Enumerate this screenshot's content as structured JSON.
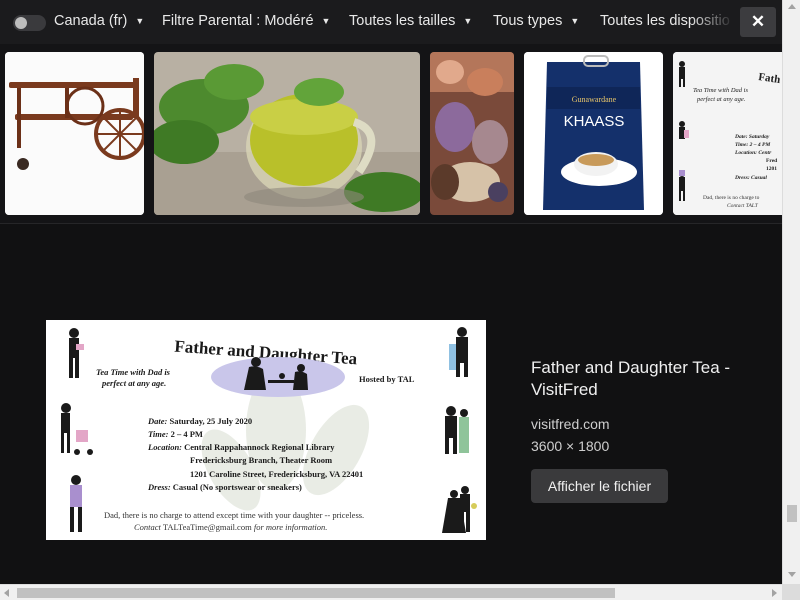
{
  "filters": {
    "safesearch_toggle": "off",
    "region": "Canada (fr)",
    "parental": "Filtre Parental : Modéré",
    "sizes": "Toutes les tailles",
    "types": "Tous types",
    "layouts": "Toutes les dispositions"
  },
  "thumbnails": [
    {
      "label": "wooden tea cart"
    },
    {
      "label": "mint tea in glass cup"
    },
    {
      "label": "tea party with stuffed animals"
    },
    {
      "label": "Khaass tea package",
      "brand": "KHAASS",
      "sub": "Gunawardane"
    },
    {
      "label": "father and daughter tea flyer"
    }
  ],
  "thumb_flyer": {
    "title": "Fath",
    "tagline_1": "Tea Time with Dad is",
    "tagline_2": "perfect at any age.",
    "date": "Date: Saturday",
    "time": "Time: 2 – 4 PM",
    "location": "Location: Centr",
    "l1": "Fred",
    "l2": "1201",
    "dress": "Dress: Casual",
    "note": "Dad, there is no charge to",
    "contact": "Contact TALT"
  },
  "preview": {
    "title": "Father and Daughter Tea - VisitFred",
    "domain": "visitfred.com",
    "dimensions": "3600 × 1800",
    "view_button": "Afficher le fichier"
  },
  "flyer": {
    "title": "Father and Daughter Tea",
    "tagline_1": "Tea Time with Dad is",
    "tagline_2": "perfect at any age.",
    "hosted": "Hosted by TAL",
    "date_label": "Date:",
    "date": "Saturday, 25 July 2020",
    "time_label": "Time:",
    "time": "2 – 4 PM",
    "location_label": "Location:",
    "location_1": "Central Rappahannock Regional Library",
    "location_2": "Fredericksburg Branch, Theater Room",
    "location_3": "1201 Caroline Street, Fredericksburg, VA 22401",
    "dress_label": "Dress:",
    "dress": "Casual (No sportswear or sneakers)",
    "note": "Dad, there is no charge to attend except time with your daughter -- priceless.",
    "contact_prefix": "Contact",
    "contact_email": "TALTeaTime@gmail.com",
    "contact_suffix": "for more information."
  },
  "colors": {
    "background": "#111112",
    "filterbar": "#1b1b1d",
    "button": "#3a3a3c",
    "oval": "#c9c6ea",
    "silhouette": "#1a1a1a",
    "accent_purple": "#a98fce",
    "accent_green": "#8fc49a",
    "accent_pink": "#e3a6c7",
    "accent_blue": "#90c1e2"
  }
}
